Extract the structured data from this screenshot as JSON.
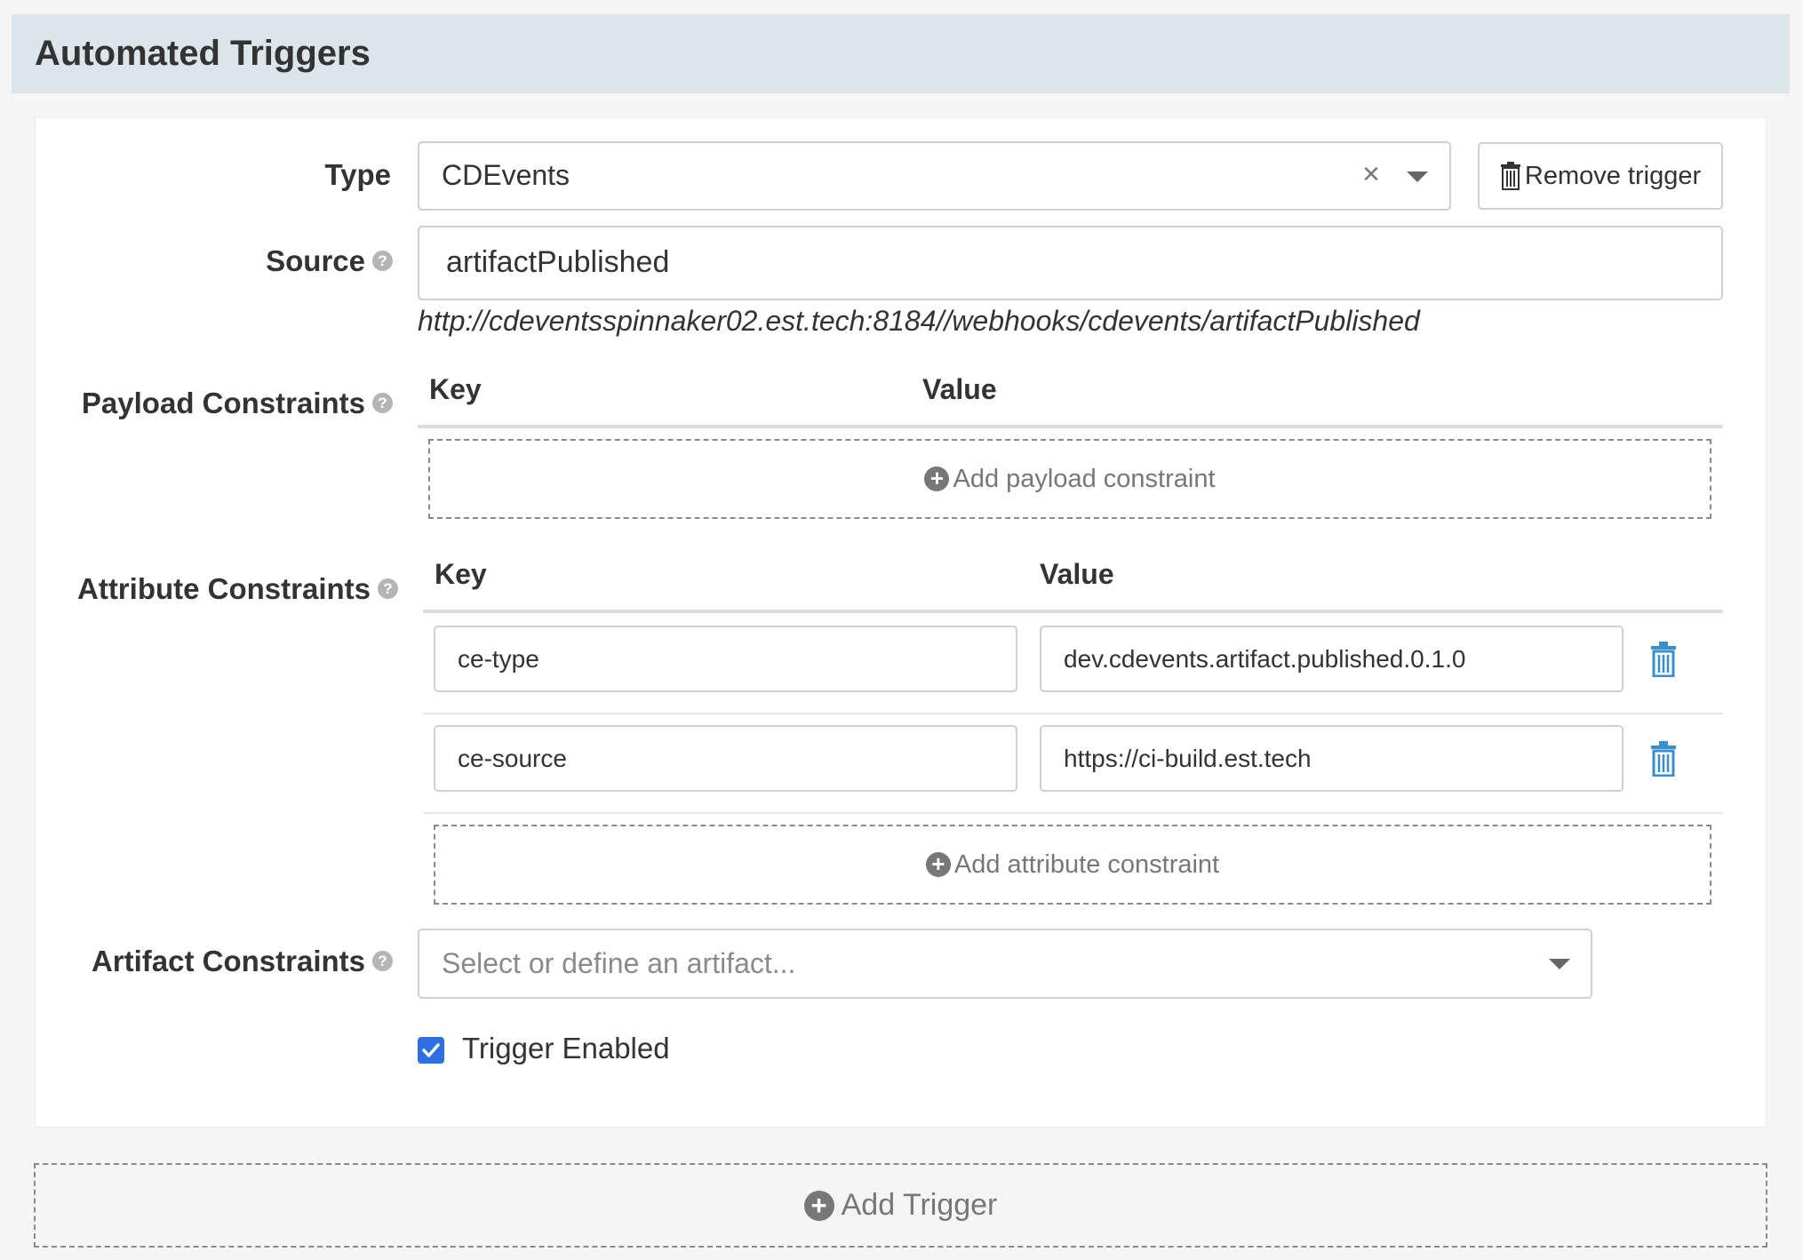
{
  "section": {
    "title": "Automated Triggers"
  },
  "trigger": {
    "type_label": "Type",
    "type_value": "CDEvents",
    "remove_label": "Remove trigger",
    "source_label": "Source",
    "source_value": "artifactPublished",
    "webhook_url": "http://cdeventsspinnaker02.est.tech:8184//webhooks/cdevents/artifactPublished"
  },
  "payload_constraints": {
    "label": "Payload Constraints",
    "key_header": "Key",
    "value_header": "Value",
    "add_label": "Add payload constraint"
  },
  "attribute_constraints": {
    "label": "Attribute Constraints",
    "key_header": "Key",
    "value_header": "Value",
    "rows": [
      {
        "key": "ce-type",
        "value": "dev.cdevents.artifact.published.0.1.0"
      },
      {
        "key": "ce-source",
        "value": "https://ci-build.est.tech"
      }
    ],
    "add_label": "Add attribute constraint"
  },
  "artifact_constraints": {
    "label": "Artifact Constraints",
    "placeholder": "Select or define an artifact..."
  },
  "enabled": {
    "label": "Trigger Enabled",
    "checked": true
  },
  "add_trigger_label": "Add Trigger",
  "colors": {
    "accent": "#2f6fe0",
    "icon": "#3a8ec9",
    "header_bg": "#dce6ea"
  }
}
